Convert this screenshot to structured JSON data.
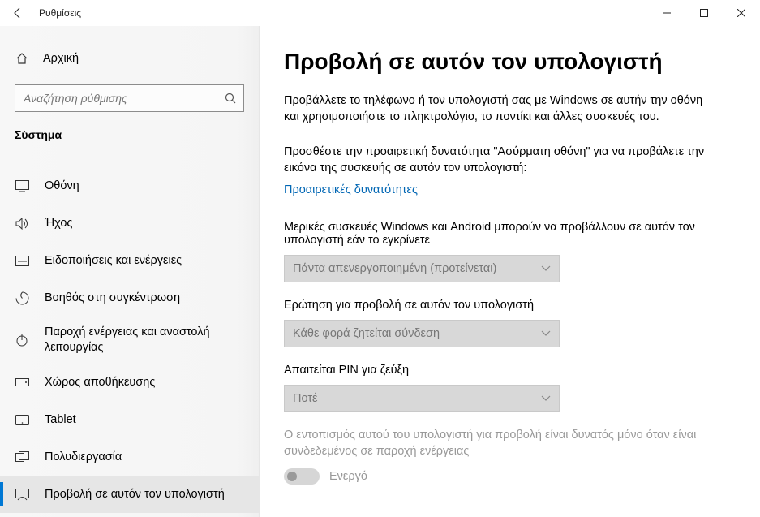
{
  "window": {
    "title": "Ρυθμίσεις"
  },
  "sidebar": {
    "home": "Αρχική",
    "search_placeholder": "Αναζήτηση ρύθμισης",
    "section": "Σύστημα",
    "items": [
      {
        "label": "Οθόνη"
      },
      {
        "label": "Ήχος"
      },
      {
        "label": "Ειδοποιήσεις και ενέργειες"
      },
      {
        "label": "Βοηθός στη συγκέντρωση"
      },
      {
        "label": "Παροχή ενέργειας και αναστολή λειτουργίας"
      },
      {
        "label": "Χώρος αποθήκευσης"
      },
      {
        "label": "Tablet"
      },
      {
        "label": "Πολυδιεργασία"
      },
      {
        "label": "Προβολή σε αυτόν τον υπολογιστή"
      }
    ]
  },
  "main": {
    "heading": "Προβολή σε αυτόν τον υπολογιστή",
    "lead": "Προβάλλετε το τηλέφωνο ή τον υπολογιστή σας με Windows σε αυτήν την οθόνη και χρησιμοποιήστε το πληκτρολόγιο, το ποντίκι και άλλες συσκευές του.",
    "sub": "Προσθέστε την προαιρετική δυνατότητα \"Ασύρματη οθόνη\" για να προβάλετε την εικόνα της συσκευής σε αυτόν τον υπολογιστή:",
    "link": "Προαιρετικές δυνατότητες",
    "q1_label": "Μερικές συσκευές Windows και Android μπορούν να προβάλλουν σε αυτόν τον υπολογιστή εάν το εγκρίνετε",
    "q1_value": "Πάντα απενεργοποιημένη (προτείνεται)",
    "q2_label": "Ερώτηση για προβολή σε αυτόν τον υπολογιστή",
    "q2_value": "Κάθε φορά ζητείται σύνδεση",
    "q3_label": "Απαιτείται PIN για ζεύξη",
    "q3_value": "Ποτέ",
    "hint": "Ο εντοπισμός αυτού του υπολογιστή για προβολή είναι δυνατός μόνο όταν είναι συνδεδεμένος σε παροχή ενέργειας",
    "toggle_label": "Ενεργό"
  }
}
